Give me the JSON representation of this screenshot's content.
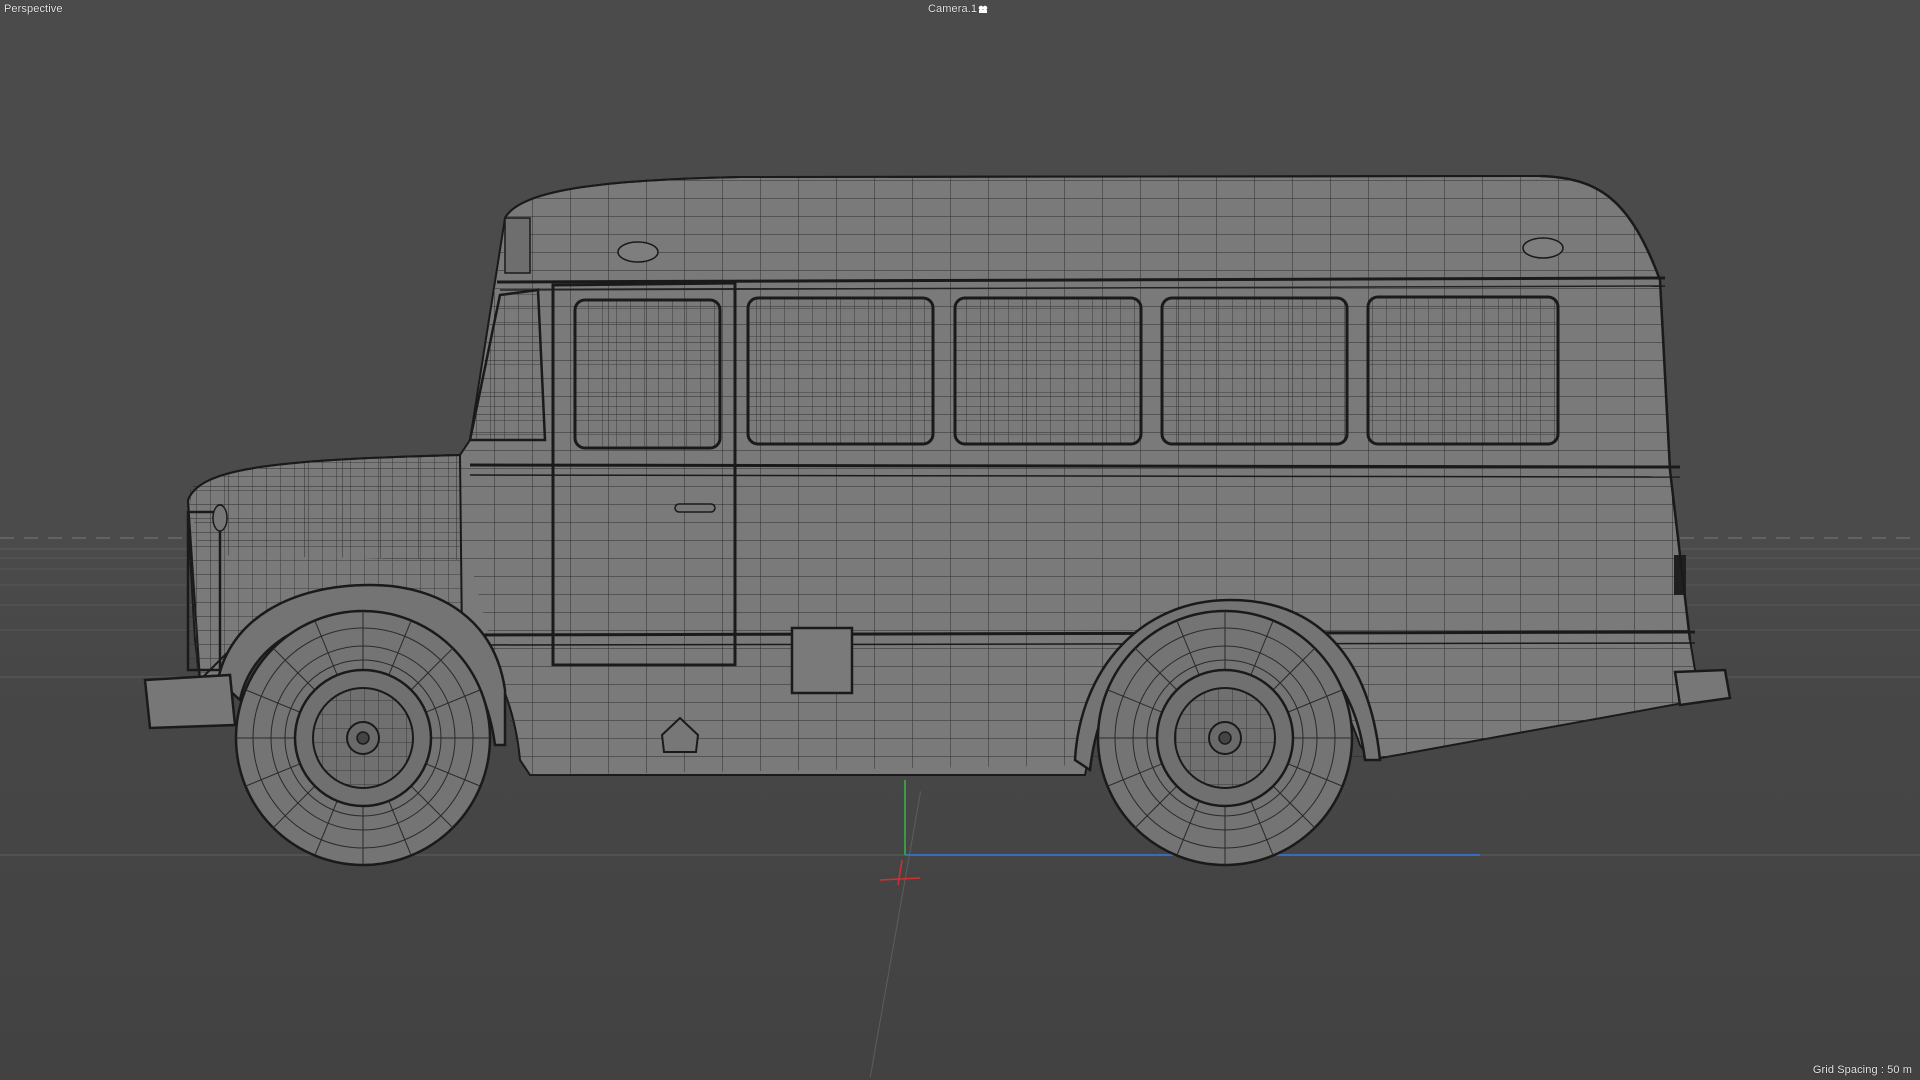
{
  "viewport": {
    "view_name": "Perspective",
    "camera_label": "Camera.1",
    "camera_icon": "camera-icon",
    "grid_spacing": "Grid Spacing : 50 m"
  },
  "scene": {
    "object": "bus-wireframe",
    "background_color": "#4b4b4b",
    "shaded_body_color": "#7a7a7a",
    "wire_color": "#1c1c1c",
    "axis_colors": {
      "x": "#d03030",
      "y": "#39b54a",
      "z": "#2f7de0"
    }
  }
}
